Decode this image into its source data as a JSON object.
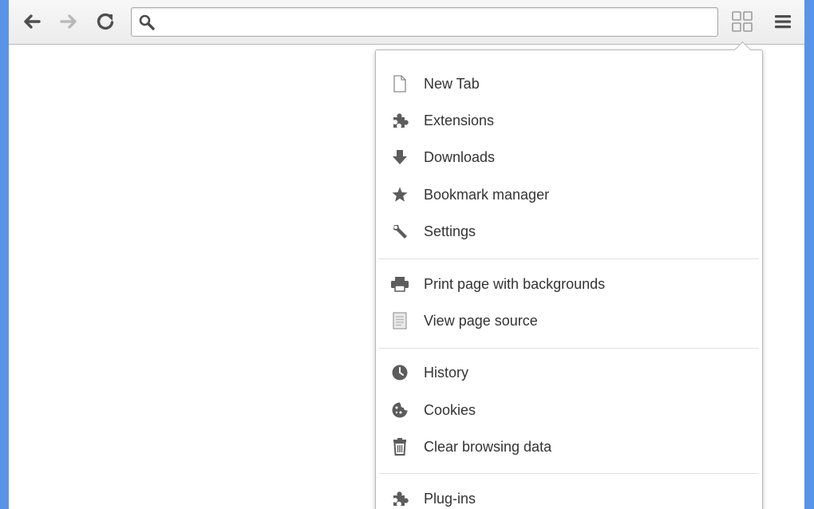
{
  "omnibox": {
    "value": "",
    "placeholder": ""
  },
  "colors": {
    "frame": "#5a94e6",
    "icon": "#5c5c5c",
    "text": "#333333"
  },
  "menu": {
    "sections": [
      {
        "items": [
          {
            "label": "New Tab",
            "icon": "page-icon"
          },
          {
            "label": "Extensions",
            "icon": "puzzle-icon"
          },
          {
            "label": "Downloads",
            "icon": "download-arrow-icon"
          },
          {
            "label": "Bookmark manager",
            "icon": "star-icon"
          },
          {
            "label": "Settings",
            "icon": "wrench-icon"
          }
        ]
      },
      {
        "items": [
          {
            "label": "Print page with backgrounds",
            "icon": "printer-icon"
          },
          {
            "label": "View page source",
            "icon": "document-lines-icon"
          }
        ]
      },
      {
        "items": [
          {
            "label": "History",
            "icon": "clock-icon"
          },
          {
            "label": "Cookies",
            "icon": "cookie-icon"
          },
          {
            "label": "Clear browsing data",
            "icon": "trash-icon"
          }
        ]
      },
      {
        "items": [
          {
            "label": "Plug-ins",
            "icon": "puzzle-icon"
          }
        ]
      }
    ]
  }
}
